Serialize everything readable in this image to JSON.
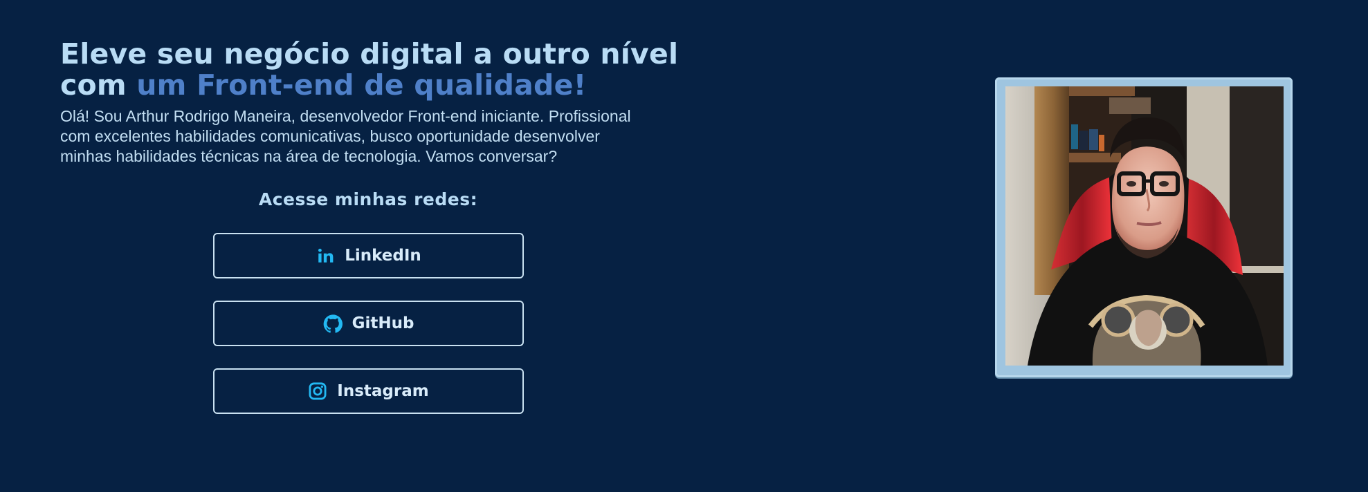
{
  "hero": {
    "title_start": "Eleve seu negócio digital a outro nível com ",
    "title_highlight": "um Front-end de qualidade!",
    "bio": "Olá! Sou Arthur Rodrigo Maneira, desenvolvedor Front-end iniciante. Profissional com excelentes habilidades comunicativas, busco oportunidade desenvolver minhas habilidades técnicas na área de tecnologia. Vamos conversar?"
  },
  "socials": {
    "title": "Acesse minhas redes:",
    "items": [
      {
        "label": "LinkedIn",
        "icon": "linkedin-icon"
      },
      {
        "label": "GitHub",
        "icon": "github-icon"
      },
      {
        "label": "Instagram",
        "icon": "instagram-icon"
      }
    ]
  },
  "profile_photo": {
    "description": "profile-photo"
  },
  "colors": {
    "background": "#062143",
    "heading": "#b9dcf5",
    "highlight": "#4f80c9",
    "icon": "#23b9f3",
    "frame": "#9fc5e0"
  }
}
